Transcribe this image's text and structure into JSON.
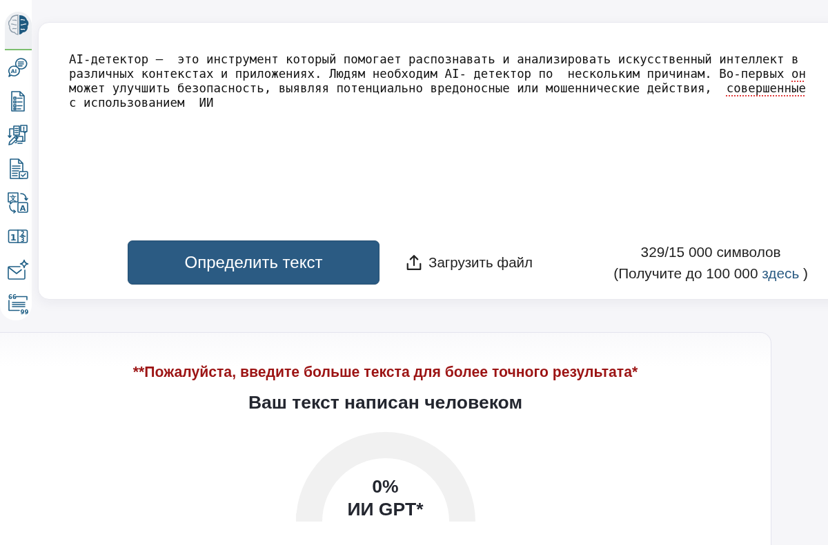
{
  "sidebar": {
    "items": [
      {
        "kind": "ai-chat",
        "glyphs": [
          "AI"
        ]
      },
      {
        "kind": "checklist"
      },
      {
        "kind": "diagram"
      },
      {
        "kind": "document-check"
      },
      {
        "kind": "translate",
        "glyphs": [
          "文",
          "A"
        ]
      },
      {
        "kind": "fraction",
        "glyphs": [
          "1",
          "2",
          "3"
        ]
      },
      {
        "kind": "mail-sparkle"
      },
      {
        "kind": "quote",
        "glyphs": [
          "66",
          "99"
        ]
      }
    ]
  },
  "editor": {
    "segments": [
      {
        "text": "AI-детектор —  это инструмент который помогает распознавать и анализировать искусственный интеллект в различных контекстах и приложениях. Людям необходим AI- детектор по  нескольким причинам. Во-первых ",
        "misspelled": false
      },
      {
        "text": "он",
        "misspelled": true
      },
      {
        "text": " может улучшить безопасность, выявляя потенциально вредоносные или мошеннические действия,  ",
        "misspelled": false
      },
      {
        "text": "совершенные",
        "misspelled": true
      },
      {
        "text": " с использованием  ИИ",
        "misspelled": false
      }
    ],
    "submit_button": "Определить текст",
    "upload": "Загрузить файл",
    "counter": "329/15 000 символов",
    "upgrade": {
      "prefix": "(Получите до 100 000",
      "link": "здесь",
      "suffix": ")"
    }
  },
  "result": {
    "warning": "**Пожалуйста, введите больше текста для более точного результата*",
    "verdict": "Ваш текст написан человеком",
    "gauge": {
      "level": 0,
      "value": "0%",
      "label": "ИИ GPT*"
    }
  }
}
